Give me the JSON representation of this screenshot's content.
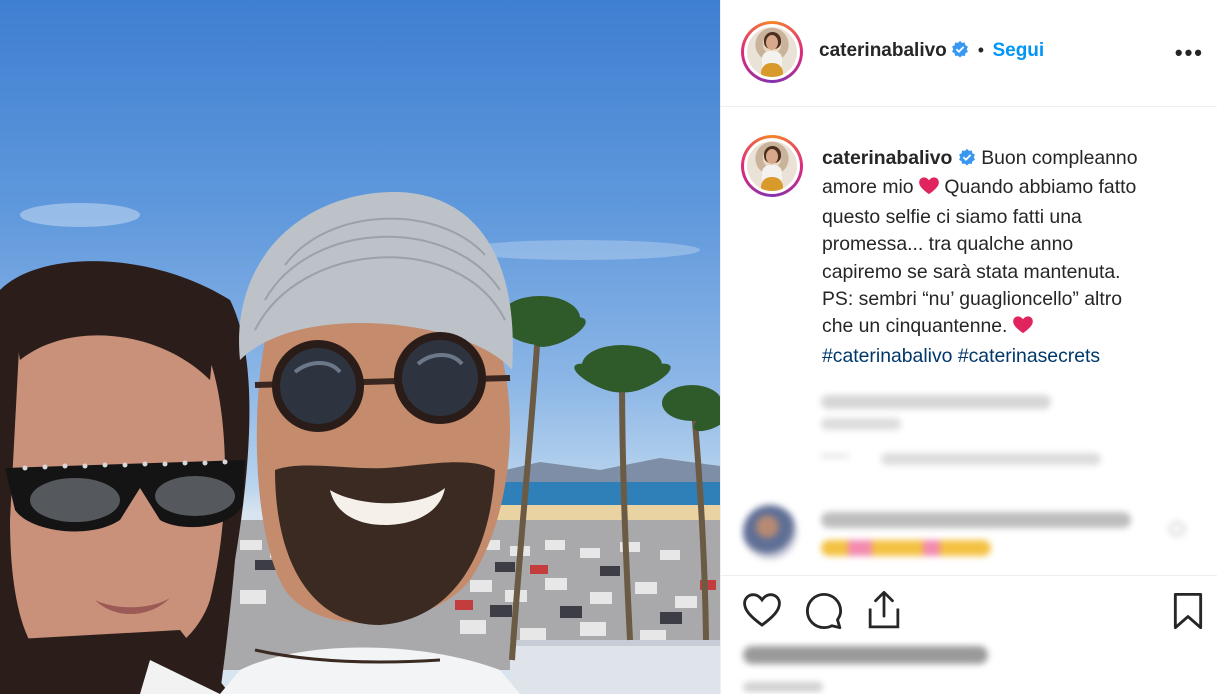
{
  "post": {
    "author": "caterinabalivo",
    "follow_label": "Segui",
    "separator": "•",
    "more_label": "•••",
    "caption_author": "caterinabalivo",
    "caption_lines": [
      "Buon compleanno",
      "amore mio",
      "Quando abbiamo fatto",
      "questo selfie ci siamo fatti una",
      "promessa... tra qualche anno",
      "capiremo se sarà stata mantenuta.",
      "PS: sembri “nu’ guaglioncello” altro",
      "che un cinquantenne."
    ],
    "hashtags": [
      "#caterinabalivo",
      "#caterinasecrets"
    ]
  },
  "colors": {
    "follow_blue": "#0095f6",
    "hashtag_blue": "#00376b",
    "verified_blue": "#3897f0",
    "heart_red": "#e0245e"
  },
  "icons": [
    "verified-badge-icon",
    "heart-emoji-icon",
    "more-options-icon",
    "like-icon",
    "comment-icon",
    "share-icon",
    "bookmark-icon"
  ]
}
